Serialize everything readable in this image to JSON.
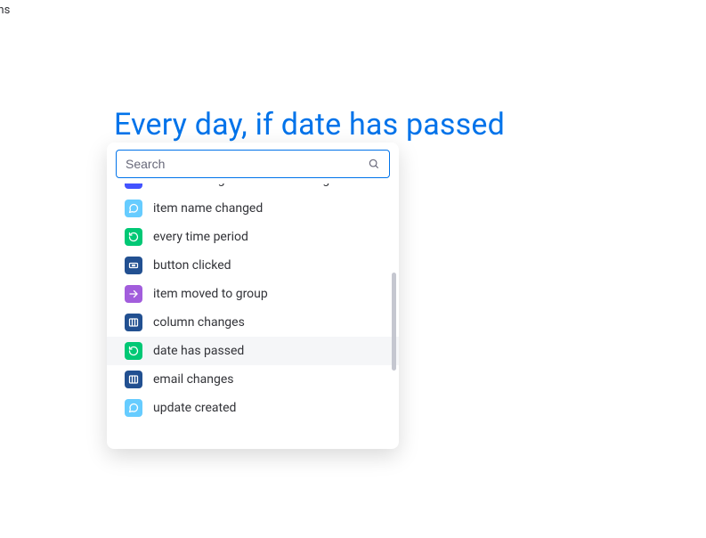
{
  "top_fragment": "ons",
  "heading": "Every day, if date has passed",
  "search": {
    "placeholder": "Search",
    "value": ""
  },
  "items": [
    {
      "label": "status changes from something to something",
      "icon": "status",
      "selected": false,
      "icon_name": "status-icon"
    },
    {
      "label": "item name changed",
      "icon": "chat",
      "selected": false,
      "icon_name": "chat-bubble-icon"
    },
    {
      "label": "every time period",
      "icon": "time",
      "selected": false,
      "icon_name": "recurring-icon"
    },
    {
      "label": "button clicked",
      "icon": "button",
      "selected": false,
      "icon_name": "button-icon"
    },
    {
      "label": "item moved to group",
      "icon": "move",
      "selected": false,
      "icon_name": "arrow-right-icon"
    },
    {
      "label": "column changes",
      "icon": "column",
      "selected": false,
      "icon_name": "column-icon"
    },
    {
      "label": "date has passed",
      "icon": "time",
      "selected": true,
      "icon_name": "recurring-icon"
    },
    {
      "label": "email changes",
      "icon": "email",
      "selected": false,
      "icon_name": "column-icon"
    },
    {
      "label": "update created",
      "icon": "chat",
      "selected": false,
      "icon_name": "chat-bubble-icon"
    }
  ]
}
